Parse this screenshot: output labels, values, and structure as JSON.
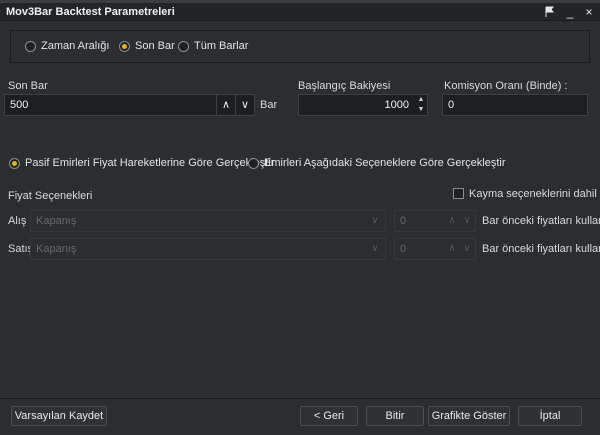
{
  "window": {
    "title": "Mov3Bar Backtest Parametreleri",
    "controls": {
      "pin_icon": "flag-icon",
      "minimize": "_",
      "close": "×"
    }
  },
  "range": {
    "options": [
      {
        "label": "Zaman Aralığı",
        "checked": false
      },
      {
        "label": "Son Bar",
        "checked": true
      },
      {
        "label": "Tüm Barlar",
        "checked": false
      }
    ]
  },
  "fields": {
    "son_bar": {
      "label": "Son Bar",
      "value": "500",
      "unit": "Bar",
      "up": "∧",
      "down": "∨"
    },
    "balance": {
      "label": "Başlangıç Bakiyesi",
      "value": "1000",
      "up": "▲",
      "down": "▼"
    },
    "commission": {
      "label": "Komisyon Oranı (Binde) :",
      "value": "0"
    }
  },
  "order_mode": {
    "options": [
      {
        "label": "Pasif Emirleri Fiyat Hareketlerine Göre Gerçekleştir",
        "checked": true
      },
      {
        "label": "Emirleri Aşağıdaki Seçeneklere Göre Gerçekleştir",
        "checked": false
      }
    ]
  },
  "price_options": {
    "title": "Fiyat Seçenekleri",
    "slippage_label": "Kayma seçeneklerini dahil et",
    "slippage_checked": false,
    "rows": [
      {
        "label": "Alış",
        "select": "Kapanış",
        "number": "0",
        "suffix": "Bar önceki fiyatları kullan"
      },
      {
        "label": "Satış :",
        "select": "Kapanış",
        "number": "0",
        "suffix": "Bar önceki fiyatları kullan"
      }
    ]
  },
  "footer": {
    "save_default": "Varsayılan Kaydet",
    "back": "< Geri",
    "finish": "Bitir",
    "show_chart": "Grafikte Göster",
    "cancel": "İptal"
  },
  "colors": {
    "accent": "#e6b31e",
    "background": "#2b2d31",
    "input": "#1d1e21"
  }
}
